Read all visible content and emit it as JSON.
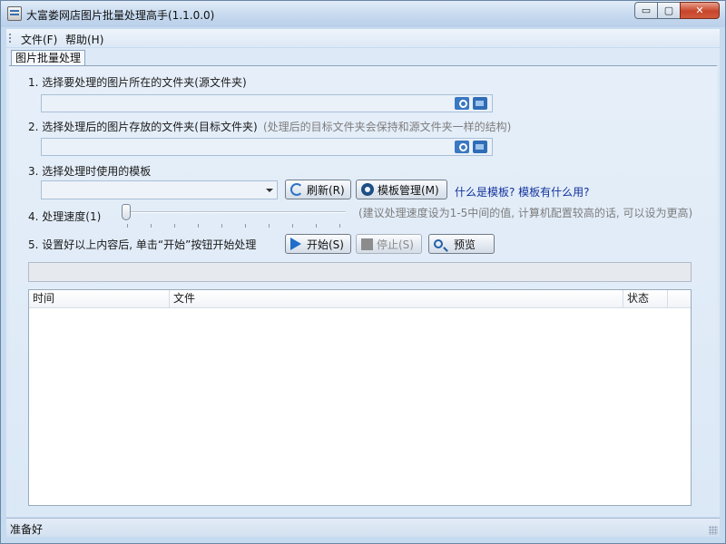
{
  "window": {
    "title": "大富娄网店图片批量处理高手(1.1.0.0)"
  },
  "caption": {
    "minimize": "▭",
    "maximize": "▢",
    "close": "✕"
  },
  "menu": {
    "items": [
      {
        "label": "文件(F)"
      },
      {
        "label": "帮助(H)"
      }
    ]
  },
  "tab": {
    "label": "图片批量处理"
  },
  "step1": {
    "label": "1. 选择要处理的图片所在的文件夹(源文件夹)",
    "value": ""
  },
  "step2": {
    "label": "2. 选择处理后的图片存放的文件夹(目标文件夹)",
    "hint": "(处理后的目标文件夹会保持和源文件夹一样的结构)",
    "value": ""
  },
  "step3": {
    "label": "3. 选择处理时使用的模板",
    "selected": "",
    "refresh_label": "刷新(R)",
    "manage_label": "模板管理(M)",
    "help_link": "什么是模板? 模板有什么用?"
  },
  "step4": {
    "label": "4. 处理速度(1)",
    "value": 1,
    "min": 1,
    "max": 10,
    "hint": "(建议处理速度设为1-5中间的值, 计算机配置较高的话, 可以设为更高)"
  },
  "step5": {
    "label": "5. 设置好以上内容后, 单击“开始”按钮开始处理",
    "start_label": "开始(S)",
    "stop_label": "停止(S)",
    "preview_label": "预览"
  },
  "progress": {
    "value": 0
  },
  "list": {
    "columns": [
      "时间",
      "文件",
      "状态"
    ],
    "rows": []
  },
  "status": {
    "text": "准备好"
  },
  "icons": {
    "app": "app-icon",
    "browse": "folder-search-icon",
    "open": "folder-open-icon",
    "refresh": "refresh-icon",
    "manage": "gear-icon",
    "start": "play-icon",
    "stop": "stop-icon",
    "preview": "magnifier-icon"
  },
  "colors": {
    "link": "#13329b",
    "hint": "#7d7d7d",
    "accent": "#1f6ec9"
  }
}
